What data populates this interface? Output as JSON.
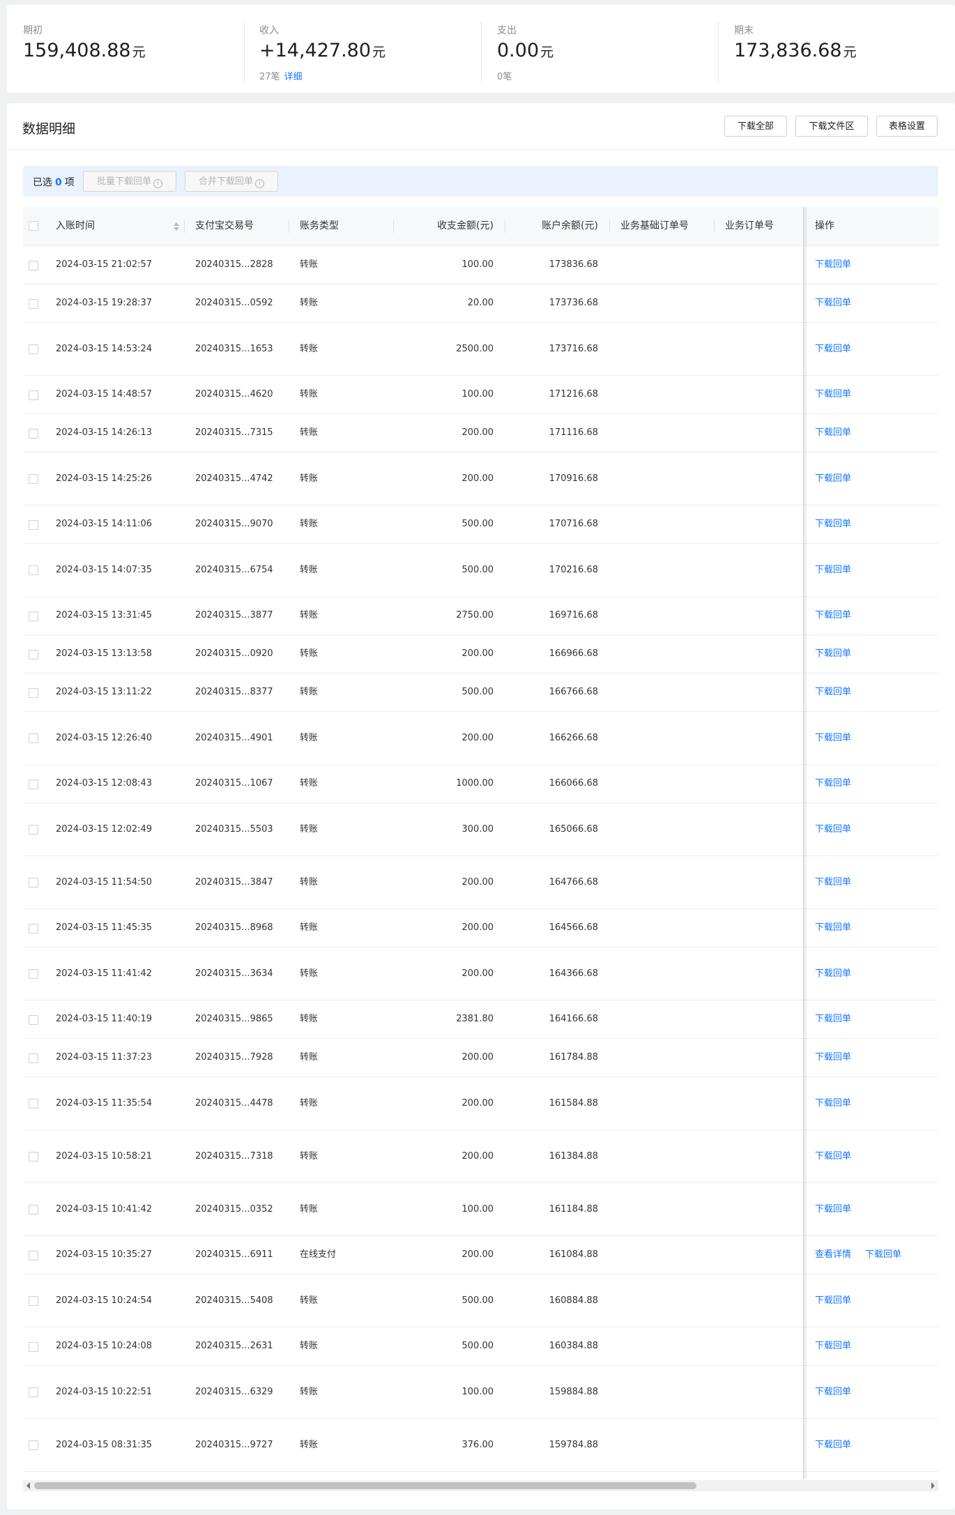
{
  "summary": [
    {
      "label": "期初",
      "value": "159,408.88",
      "unit": "元",
      "count": "",
      "link": ""
    },
    {
      "label": "收入",
      "value": "+14,427.80",
      "unit": "元",
      "count": "27笔",
      "link": "详细"
    },
    {
      "label": "支出",
      "value": "0.00",
      "unit": "元",
      "count": "0笔",
      "link": ""
    },
    {
      "label": "期末",
      "value": "173,836.68",
      "unit": "元",
      "count": "",
      "link": ""
    }
  ],
  "detail": {
    "title": "数据明细",
    "buttons": [
      "下载全部",
      "下载文件区",
      "表格设置"
    ]
  },
  "selection": {
    "prefix": "已选",
    "count": "0",
    "suffix": "项",
    "batch_download": "批量下载回单",
    "merge_download": "合并下载回单"
  },
  "table": {
    "headers": [
      "入账时间",
      "支付宝交易号",
      "账务类型",
      "收支金额(元)",
      "账户余额(元)",
      "业务基础订单号",
      "业务订单号",
      "操作"
    ],
    "rows": [
      {
        "time": "2024-03-15 21:02:57",
        "trade_no": "20240315...2828",
        "type": "转账",
        "amount": "100.00",
        "balance": "173836.68",
        "actions": [
          "下载回单"
        ]
      },
      {
        "time": "2024-03-15 19:28:37",
        "trade_no": "20240315...0592",
        "type": "转账",
        "amount": "20.00",
        "balance": "173736.68",
        "actions": [
          "下载回单"
        ]
      },
      {
        "time": "2024-03-15 14:53:24",
        "trade_no": "20240315...1653",
        "type": "转账",
        "amount": "2500.00",
        "balance": "173716.68",
        "actions": [
          "下载回单"
        ]
      },
      {
        "time": "2024-03-15 14:48:57",
        "trade_no": "20240315...4620",
        "type": "转账",
        "amount": "100.00",
        "balance": "171216.68",
        "actions": [
          "下载回单"
        ]
      },
      {
        "time": "2024-03-15 14:26:13",
        "trade_no": "20240315...7315",
        "type": "转账",
        "amount": "200.00",
        "balance": "171116.68",
        "actions": [
          "下载回单"
        ]
      },
      {
        "time": "2024-03-15 14:25:26",
        "trade_no": "20240315...4742",
        "type": "转账",
        "amount": "200.00",
        "balance": "170916.68",
        "actions": [
          "下载回单"
        ]
      },
      {
        "time": "2024-03-15 14:11:06",
        "trade_no": "20240315...9070",
        "type": "转账",
        "amount": "500.00",
        "balance": "170716.68",
        "actions": [
          "下载回单"
        ]
      },
      {
        "time": "2024-03-15 14:07:35",
        "trade_no": "20240315...6754",
        "type": "转账",
        "amount": "500.00",
        "balance": "170216.68",
        "actions": [
          "下载回单"
        ]
      },
      {
        "time": "2024-03-15 13:31:45",
        "trade_no": "20240315...3877",
        "type": "转账",
        "amount": "2750.00",
        "balance": "169716.68",
        "actions": [
          "下载回单"
        ]
      },
      {
        "time": "2024-03-15 13:13:58",
        "trade_no": "20240315...0920",
        "type": "转账",
        "amount": "200.00",
        "balance": "166966.68",
        "actions": [
          "下载回单"
        ]
      },
      {
        "time": "2024-03-15 13:11:22",
        "trade_no": "20240315...8377",
        "type": "转账",
        "amount": "500.00",
        "balance": "166766.68",
        "actions": [
          "下载回单"
        ]
      },
      {
        "time": "2024-03-15 12:26:40",
        "trade_no": "20240315...4901",
        "type": "转账",
        "amount": "200.00",
        "balance": "166266.68",
        "actions": [
          "下载回单"
        ]
      },
      {
        "time": "2024-03-15 12:08:43",
        "trade_no": "20240315...1067",
        "type": "转账",
        "amount": "1000.00",
        "balance": "166066.68",
        "actions": [
          "下载回单"
        ]
      },
      {
        "time": "2024-03-15 12:02:49",
        "trade_no": "20240315...5503",
        "type": "转账",
        "amount": "300.00",
        "balance": "165066.68",
        "actions": [
          "下载回单"
        ]
      },
      {
        "time": "2024-03-15 11:54:50",
        "trade_no": "20240315...3847",
        "type": "转账",
        "amount": "200.00",
        "balance": "164766.68",
        "actions": [
          "下载回单"
        ]
      },
      {
        "time": "2024-03-15 11:45:35",
        "trade_no": "20240315...8968",
        "type": "转账",
        "amount": "200.00",
        "balance": "164566.68",
        "actions": [
          "下载回单"
        ]
      },
      {
        "time": "2024-03-15 11:41:42",
        "trade_no": "20240315...3634",
        "type": "转账",
        "amount": "200.00",
        "balance": "164366.68",
        "actions": [
          "下载回单"
        ]
      },
      {
        "time": "2024-03-15 11:40:19",
        "trade_no": "20240315...9865",
        "type": "转账",
        "amount": "2381.80",
        "balance": "164166.68",
        "actions": [
          "下载回单"
        ]
      },
      {
        "time": "2024-03-15 11:37:23",
        "trade_no": "20240315...7928",
        "type": "转账",
        "amount": "200.00",
        "balance": "161784.88",
        "actions": [
          "下载回单"
        ]
      },
      {
        "time": "2024-03-15 11:35:54",
        "trade_no": "20240315...4478",
        "type": "转账",
        "amount": "200.00",
        "balance": "161584.88",
        "actions": [
          "下载回单"
        ]
      },
      {
        "time": "2024-03-15 10:58:21",
        "trade_no": "20240315...7318",
        "type": "转账",
        "amount": "200.00",
        "balance": "161384.88",
        "actions": [
          "下载回单"
        ]
      },
      {
        "time": "2024-03-15 10:41:42",
        "trade_no": "20240315...0352",
        "type": "转账",
        "amount": "100.00",
        "balance": "161184.88",
        "actions": [
          "下载回单"
        ]
      },
      {
        "time": "2024-03-15 10:35:27",
        "trade_no": "20240315...6911",
        "type": "在线支付",
        "amount": "200.00",
        "balance": "161084.88",
        "actions": [
          "查看详情",
          "下载回单"
        ]
      },
      {
        "time": "2024-03-15 10:24:54",
        "trade_no": "20240315...5408",
        "type": "转账",
        "amount": "500.00",
        "balance": "160884.88",
        "actions": [
          "下载回单"
        ]
      },
      {
        "time": "2024-03-15 10:24:08",
        "trade_no": "20240315...2631",
        "type": "转账",
        "amount": "500.00",
        "balance": "160384.88",
        "actions": [
          "下载回单"
        ]
      },
      {
        "time": "2024-03-15 10:22:51",
        "trade_no": "20240315...6329",
        "type": "转账",
        "amount": "100.00",
        "balance": "159884.88",
        "actions": [
          "下载回单"
        ]
      },
      {
        "time": "2024-03-15 08:31:35",
        "trade_no": "20240315...9727",
        "type": "转账",
        "amount": "376.00",
        "balance": "159784.88",
        "actions": [
          "下载回单"
        ]
      }
    ]
  },
  "colors": {
    "accent": "#1677ff",
    "header_bg": "#f7f8fa",
    "selection_bg": "#eaf2fd"
  }
}
